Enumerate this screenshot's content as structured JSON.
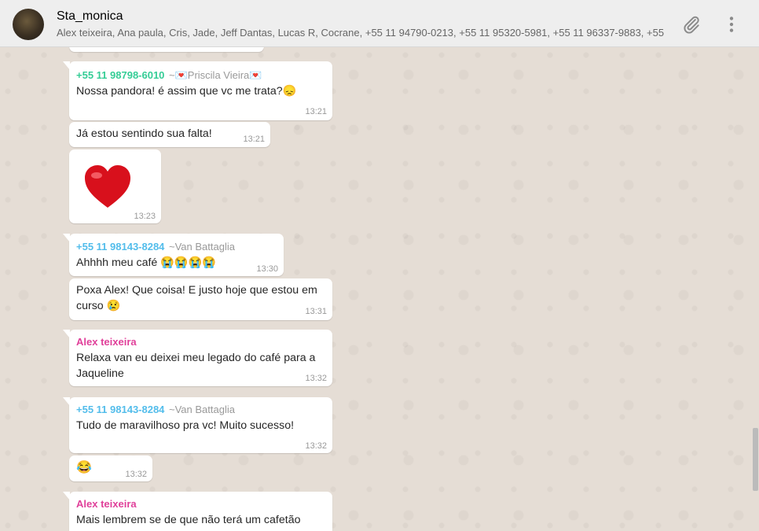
{
  "header": {
    "title": "Sta_monica",
    "participants": "Alex teixeira, Ana paula, Cris, Jade, Jeff Dantas, Lucas R, Cocrane, +55 11 94790-0213, +55 11 95320-5981, +55 11 96337-9883, +55 ...",
    "icons": [
      "paperclip-icon",
      "more-vertical-icon"
    ]
  },
  "messages": [
    {
      "sender": "+55 11 98798-6010",
      "alias": "~💌Priscila Vieira💌",
      "text": "Nossa pandora! é assim que vc me trata?😞",
      "time": "13:21"
    },
    {
      "text": "Já estou sentindo sua falta!",
      "time": "13:21"
    },
    {
      "emoji": "❤️",
      "time": "13:23"
    },
    {
      "sender": "+55 11 98143-8284",
      "alias": "~Van Battaglia",
      "text": "Ahhhh meu café 😭😭😭😭",
      "time": "13:30"
    },
    {
      "text_line1": "Poxa Alex! Que coisa! E justo hoje que estou em",
      "text_line2": "curso 😢",
      "time": "13:31"
    },
    {
      "sender": "Alex teixeira",
      "text_line1": "Relaxa van eu deixei meu legado do café para a",
      "text_line2": "Jaqueline",
      "time": "13:32"
    },
    {
      "sender": "+55 11 98143-8284",
      "alias": "~Van Battaglia",
      "text": "Tudo de maravilhoso pra vc!  Muito sucesso!",
      "time": "13:32"
    },
    {
      "emoji": "😂",
      "time": "13:32"
    },
    {
      "sender": "Alex teixeira",
      "text": "Mais lembrem se de que não terá um cafetão"
    }
  ]
}
